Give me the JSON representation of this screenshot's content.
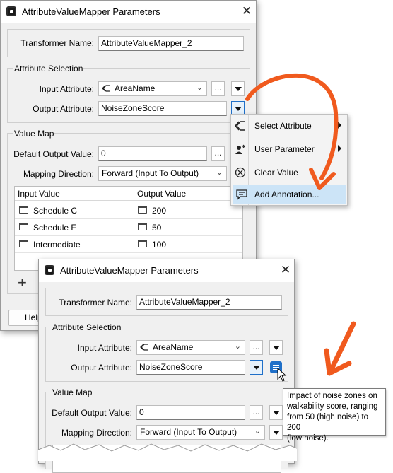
{
  "dialog1": {
    "title": "AttributeValueMapper Parameters",
    "close": "✕",
    "transformer_label": "Transformer Name:",
    "transformer_value": "AttributeValueMapper_2",
    "attr_group": "Attribute Selection",
    "input_label": "Input Attribute:",
    "input_value": "AreaName",
    "output_label": "Output Attribute:",
    "output_value": "NoiseZoneScore",
    "value_group": "Value Map",
    "default_label": "Default Output Value:",
    "default_value": "0",
    "mapping_label": "Mapping Direction:",
    "mapping_value": "Forward (Input To Output)",
    "col_input": "Input Value",
    "col_output": "Output Value",
    "rows": [
      {
        "input": "Schedule C",
        "output": "200"
      },
      {
        "input": "Schedule F",
        "output": "50"
      },
      {
        "input": "Intermediate",
        "output": "100"
      }
    ],
    "add": "+",
    "help": "Help",
    "ellipsis": "..."
  },
  "menu": {
    "items": [
      {
        "label": "Select Attribute",
        "icon": "attribute-icon"
      },
      {
        "label": "User Parameter",
        "icon": "user-parameter-icon"
      },
      {
        "label": "Clear Value",
        "icon": "clear-icon"
      },
      {
        "label": "Add Annotation...",
        "icon": "annotation-icon"
      }
    ]
  },
  "dialog2": {
    "title": "AttributeValueMapper Parameters",
    "close": "✕",
    "transformer_label": "Transformer Name:",
    "transformer_value": "AttributeValueMapper_2",
    "attr_group": "Attribute Selection",
    "input_label": "Input Attribute:",
    "input_value": "AreaName",
    "output_label": "Output Attribute:",
    "output_value": "NoiseZoneScore",
    "value_group": "Value Map",
    "default_label": "Default Output Value:",
    "default_value": "0",
    "mapping_label": "Mapping Direction:",
    "mapping_value": "Forward (Input To Output)",
    "ellipsis": "..."
  },
  "tooltip": "Impact of noise zones on\nwalkability score, ranging\nfrom 50 (high noise) to 200\n(low noise).",
  "colors": {
    "accent": "#1f6fc8",
    "arrow": "#f05a1e",
    "highlight": "#cce4f7"
  }
}
